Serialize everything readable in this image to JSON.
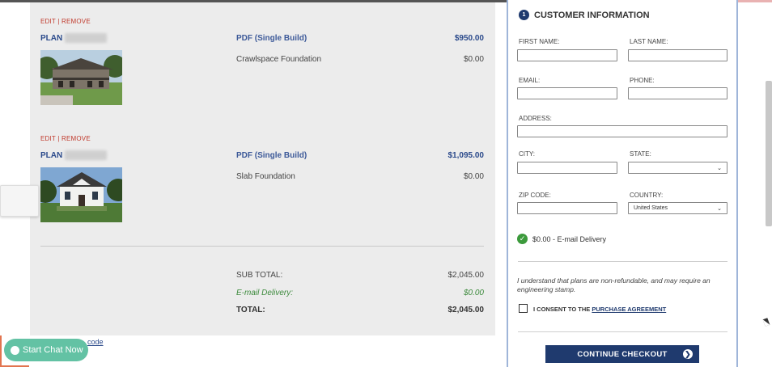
{
  "cart": {
    "items": [
      {
        "edit_remove": "EDIT | REMOVE",
        "plan_label": "PLAN",
        "product": "PDF (Single Build)",
        "price": "$950.00",
        "option_name": "Crawlspace Foundation",
        "option_price": "$0.00"
      },
      {
        "edit_remove": "EDIT | REMOVE",
        "plan_label": "PLAN",
        "product": "PDF (Single Build)",
        "price": "$1,095.00",
        "option_name": "Slab Foundation",
        "option_price": "$0.00"
      }
    ],
    "subtotal_label": "SUB TOTAL:",
    "subtotal_value": "$2,045.00",
    "delivery_label": "E-mail Delivery:",
    "delivery_value": "$0.00",
    "total_label": "TOTAL:",
    "total_value": "$2,045.00",
    "code_link": "code"
  },
  "chat": {
    "label": "Start Chat Now"
  },
  "checkout": {
    "step_number": "1",
    "title": "CUSTOMER INFORMATION",
    "fields": {
      "first_name": "FIRST NAME:",
      "last_name": "LAST NAME:",
      "email": "EMAIL:",
      "phone": "PHONE:",
      "address": "ADDRESS:",
      "city": "CITY:",
      "state": "STATE:",
      "zip": "ZIP CODE:",
      "country": "COUNTRY:"
    },
    "country_value": "United States",
    "delivery_note": "$0.00 - E-mail Delivery",
    "disclaimer": "I understand that plans are non-refundable, and may require an engineering stamp.",
    "consent_prefix": "I CONSENT TO THE ",
    "consent_link": "PURCHASE AGREEMENT",
    "button_label": "CONTINUE CHECKOUT"
  },
  "colors": {
    "navy": "#1f3a6e",
    "chat_green": "#63c2a4",
    "link_red": "#c0392b",
    "success_green": "#3c9a3c"
  }
}
